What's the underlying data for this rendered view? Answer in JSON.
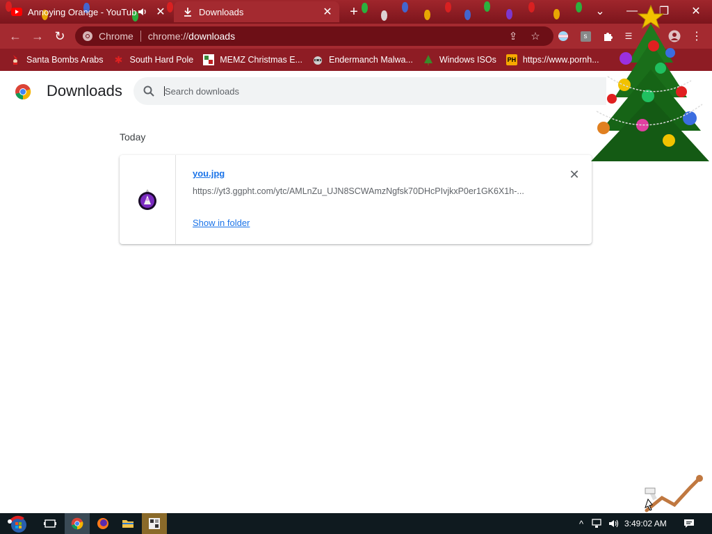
{
  "tabs": [
    {
      "title": "Annoying Orange - YouTube",
      "favicon": "youtube-icon",
      "audio": true,
      "active": false
    },
    {
      "title": "Downloads",
      "favicon": "download-icon",
      "active": true
    }
  ],
  "omnibox": {
    "chip": "Chrome",
    "scheme": "chrome://",
    "host": "downloads"
  },
  "bookmarks": [
    {
      "label": "Santa Bombs Arabs",
      "icon": "santa-icon"
    },
    {
      "label": "South Hard Pole",
      "icon": "snowflake-icon"
    },
    {
      "label": "MEMZ Christmas E...",
      "icon": "memz-icon"
    },
    {
      "label": "Endermanch Malwa...",
      "icon": "raccoon-icon"
    },
    {
      "label": "Windows ISOs",
      "icon": "tree-icon"
    },
    {
      "label": "https://www.pornh...",
      "icon": "ph-icon",
      "icon_text": "PH"
    }
  ],
  "page": {
    "title": "Downloads",
    "search_placeholder": "Search downloads",
    "section_date": "Today"
  },
  "downloads": [
    {
      "file_name": "you.jpg",
      "url": "https://yt3.ggpht.com/ytc/AMLnZu_UJN8SCWAmzNgfsk70DHcPIvjkxP0er1GK6X1h-...",
      "action": "Show in folder"
    }
  ],
  "taskbar": {
    "clock": "3:49:02 AM"
  },
  "colors": {
    "frame": "#8e1c24",
    "tab_active": "#a42a30",
    "link": "#1a73e8",
    "taskbar": "#0f1a1f"
  }
}
